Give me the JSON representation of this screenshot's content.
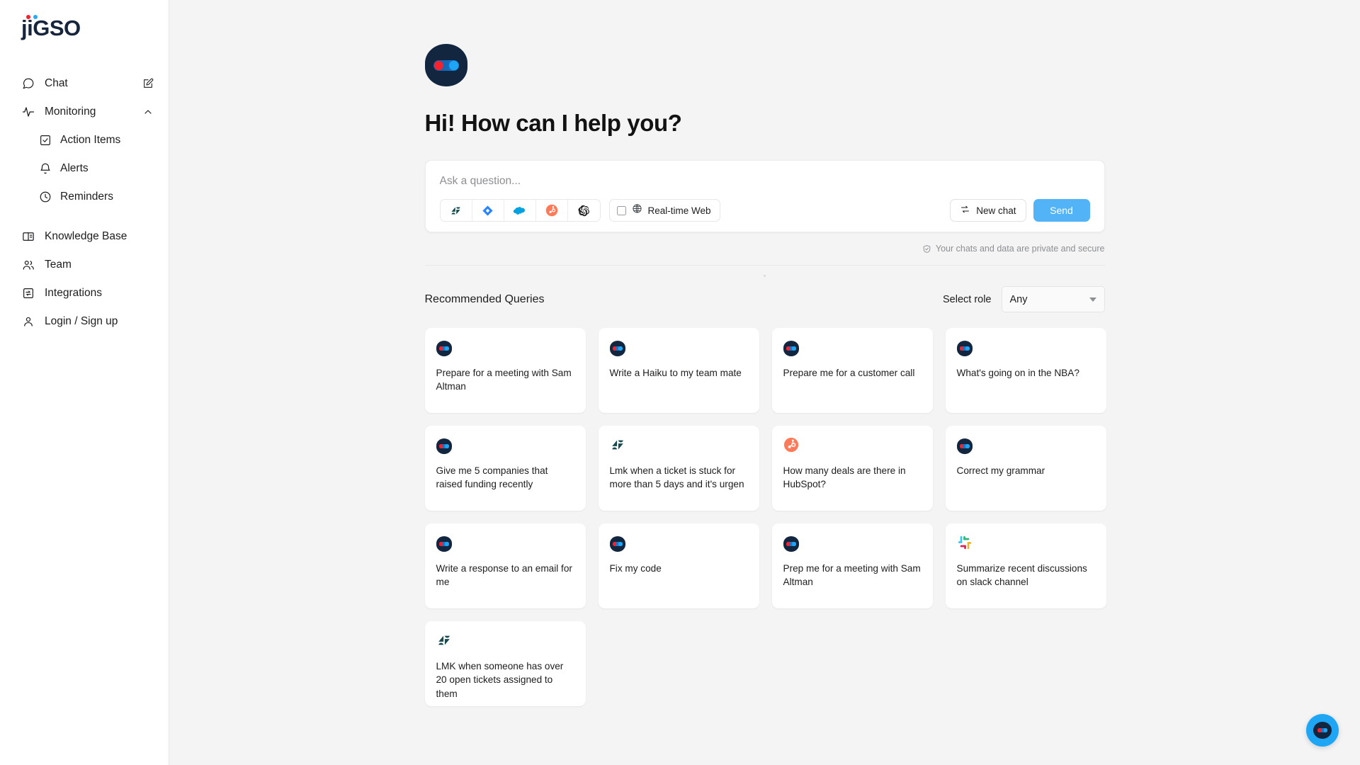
{
  "app": {
    "logo_text": "jiGSO",
    "logo_dot_red": "#f5222d",
    "logo_dot_blue": "#29a9f2",
    "accent_color": "#52b4f7"
  },
  "sidebar": {
    "items": [
      {
        "label": "Chat",
        "icon": "chat-bubble-icon",
        "trailing_icon": "compose-pencil-icon"
      },
      {
        "label": "Monitoring",
        "icon": "activity-pulse-icon",
        "trailing_icon": "chevron-up-icon"
      },
      {
        "label": "Action Items",
        "icon": "checkbox-square-icon"
      },
      {
        "label": "Alerts",
        "icon": "bell-icon"
      },
      {
        "label": "Reminders",
        "icon": "clock-icon"
      },
      {
        "label": "Knowledge Base",
        "icon": "book-icon"
      },
      {
        "label": "Team",
        "icon": "people-icon"
      },
      {
        "label": "Integrations",
        "icon": "integrations-icon"
      },
      {
        "label": "Login / Sign up",
        "icon": "user-icon"
      }
    ]
  },
  "main": {
    "avatar_icon": "jigso-bot-avatar",
    "greeting": "Hi! How can I help you?",
    "composer": {
      "placeholder": "Ask a question...",
      "value": "",
      "tools": [
        {
          "name": "zendesk-icon",
          "title": "Zendesk"
        },
        {
          "name": "jira-icon",
          "title": "Jira"
        },
        {
          "name": "salesforce-icon",
          "title": "Salesforce"
        },
        {
          "name": "hubspot-icon",
          "title": "HubSpot"
        },
        {
          "name": "openai-icon",
          "title": "OpenAI"
        }
      ],
      "realtime_web_label": "Real-time Web",
      "realtime_web_checked": false,
      "new_chat_label": "New chat",
      "send_label": "Send"
    },
    "privacy_note": "Your chats and data are private and secure",
    "recommended": {
      "title": "Recommended Queries",
      "role_label": "Select role",
      "role_value": "Any",
      "role_options": [
        "Any"
      ],
      "cards": [
        {
          "icon": "jigso-bot-avatar",
          "text": "Prepare for a meeting with Sam Altman"
        },
        {
          "icon": "jigso-bot-avatar",
          "text": "Write a Haiku to my team mate"
        },
        {
          "icon": "jigso-bot-avatar",
          "text": "Prepare me for a customer call"
        },
        {
          "icon": "jigso-bot-avatar",
          "text": "What's going on in the NBA?"
        },
        {
          "icon": "jigso-bot-avatar",
          "text": "Give me 5 companies that raised funding recently"
        },
        {
          "icon": "zendesk-icon",
          "text": "Lmk when a ticket is stuck for more than 5 days and it's urgen"
        },
        {
          "icon": "hubspot-icon",
          "text": "How many deals are there in HubSpot?"
        },
        {
          "icon": "jigso-bot-avatar",
          "text": "Correct my grammar"
        },
        {
          "icon": "jigso-bot-avatar",
          "text": "Write a response to an email for me"
        },
        {
          "icon": "jigso-bot-avatar",
          "text": "Fix my code"
        },
        {
          "icon": "jigso-bot-avatar",
          "text": "Prep me for a meeting with Sam Altman"
        },
        {
          "icon": "slack-icon",
          "text": "Summarize recent discussions on slack channel"
        },
        {
          "icon": "zendesk-icon",
          "text": "LMK when someone has over 20 open tickets assigned to them"
        }
      ]
    },
    "fab_icon": "jigso-chat-fab"
  }
}
